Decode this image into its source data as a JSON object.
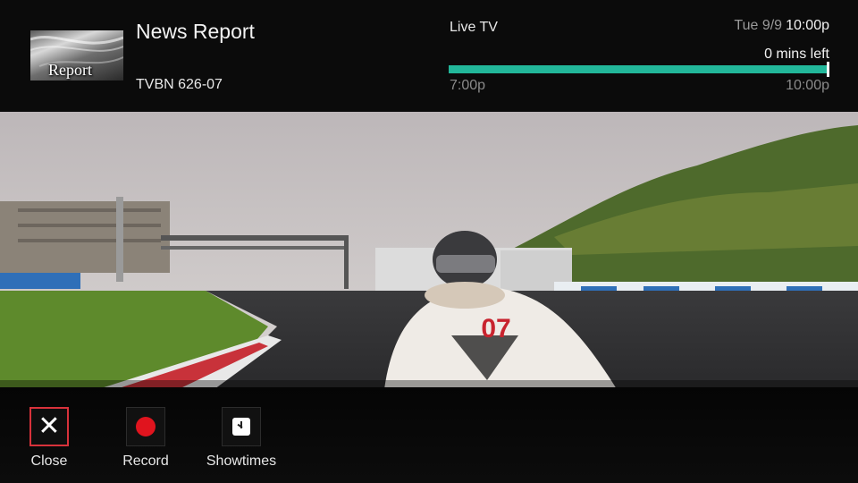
{
  "program": {
    "title": "News Report",
    "thumbnail_text": "Report",
    "channel": "TVBN 626-07"
  },
  "status": {
    "source": "Live TV",
    "date": "Tue 9/9",
    "time": "10:00p",
    "remaining": "0 mins left",
    "start": "7:00p",
    "end": "10:00p",
    "progress_percent": 100,
    "progress_color": "#22b79a"
  },
  "video": {
    "kart_number": "07"
  },
  "actions": [
    {
      "label": "Close",
      "icon": "close-icon",
      "focused": true
    },
    {
      "label": "Record",
      "icon": "record-icon",
      "focused": false
    },
    {
      "label": "Showtimes",
      "icon": "clock-icon",
      "focused": false
    }
  ],
  "colors": {
    "accent": "#22b79a",
    "focus_border": "#d8323b",
    "record": "#e0141e"
  }
}
